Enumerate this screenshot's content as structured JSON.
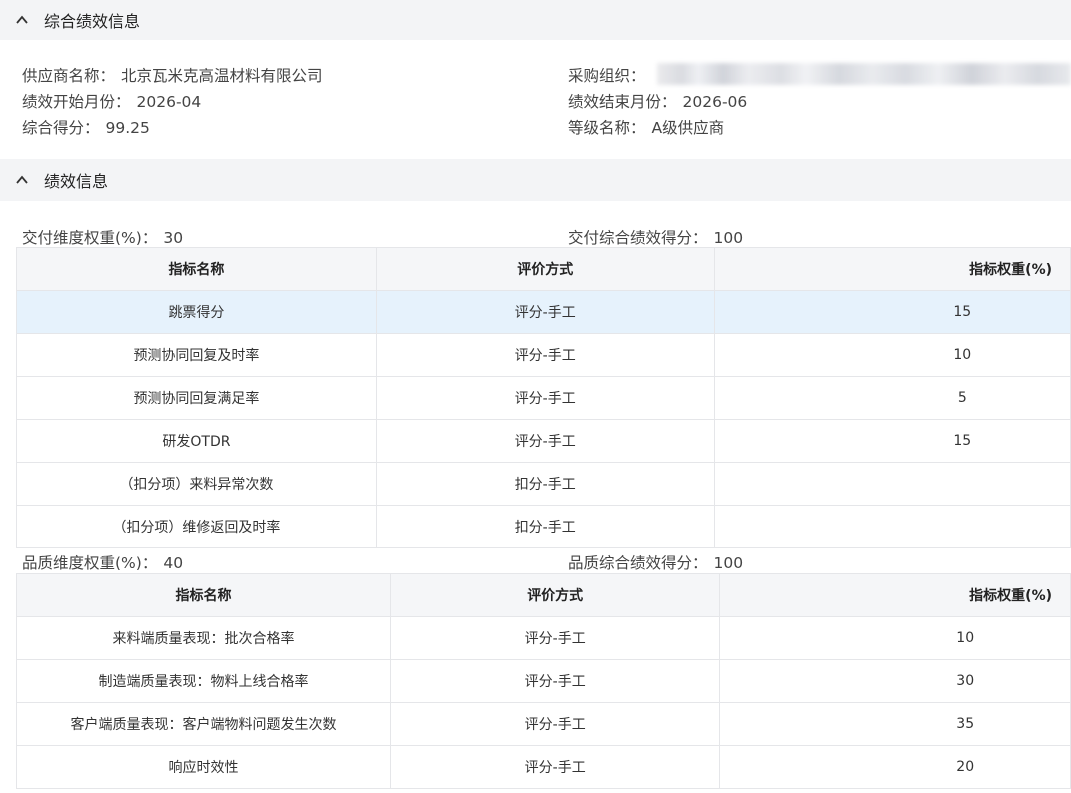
{
  "overall": {
    "title": "综合绩效信息",
    "supplier_label": "供应商名称：",
    "supplier_value": "北京瓦米克高温材料有限公司",
    "org_label": "采购组织：",
    "start_label": "绩效开始月份：",
    "start_value": "2026-04",
    "end_label": "绩效结束月份：",
    "end_value": "2026-06",
    "score_label": "综合得分：",
    "score_value": "99.25",
    "grade_label": "等级名称：",
    "grade_value": "A级供应商"
  },
  "perf": {
    "title": "绩效信息",
    "headers": [
      "指标名称",
      "评价方式",
      "指标权重(%)"
    ],
    "delivery": {
      "weight_label": "交付维度权重(%)：",
      "weight_value": "30",
      "score_label": "交付综合绩效得分：",
      "score_value": "100",
      "rows": [
        {
          "name": "跳票得分",
          "method": "评分-手工",
          "weight": "15"
        },
        {
          "name": "预测协同回复及时率",
          "method": "评分-手工",
          "weight": "10"
        },
        {
          "name": "预测协同回复满足率",
          "method": "评分-手工",
          "weight": "5"
        },
        {
          "name": "研发OTDR",
          "method": "评分-手工",
          "weight": "15"
        },
        {
          "name": "（扣分项）来料异常次数",
          "method": "扣分-手工",
          "weight": ""
        },
        {
          "name": "（扣分项）维修返回及时率",
          "method": "扣分-手工",
          "weight": ""
        }
      ]
    },
    "quality": {
      "weight_label": "品质维度权重(%)：",
      "weight_value": "40",
      "score_label": "品质综合绩效得分：",
      "score_value": "100",
      "rows": [
        {
          "name": "来料端质量表现：批次合格率",
          "method": "评分-手工",
          "weight": "10"
        },
        {
          "name": "制造端质量表现：物料上线合格率",
          "method": "评分-手工",
          "weight": "30"
        },
        {
          "name": "客户端质量表现：客户端物料问题发生次数",
          "method": "评分-手工",
          "weight": "35"
        },
        {
          "name": "响应时效性",
          "method": "评分-手工",
          "weight": "20"
        }
      ]
    }
  }
}
